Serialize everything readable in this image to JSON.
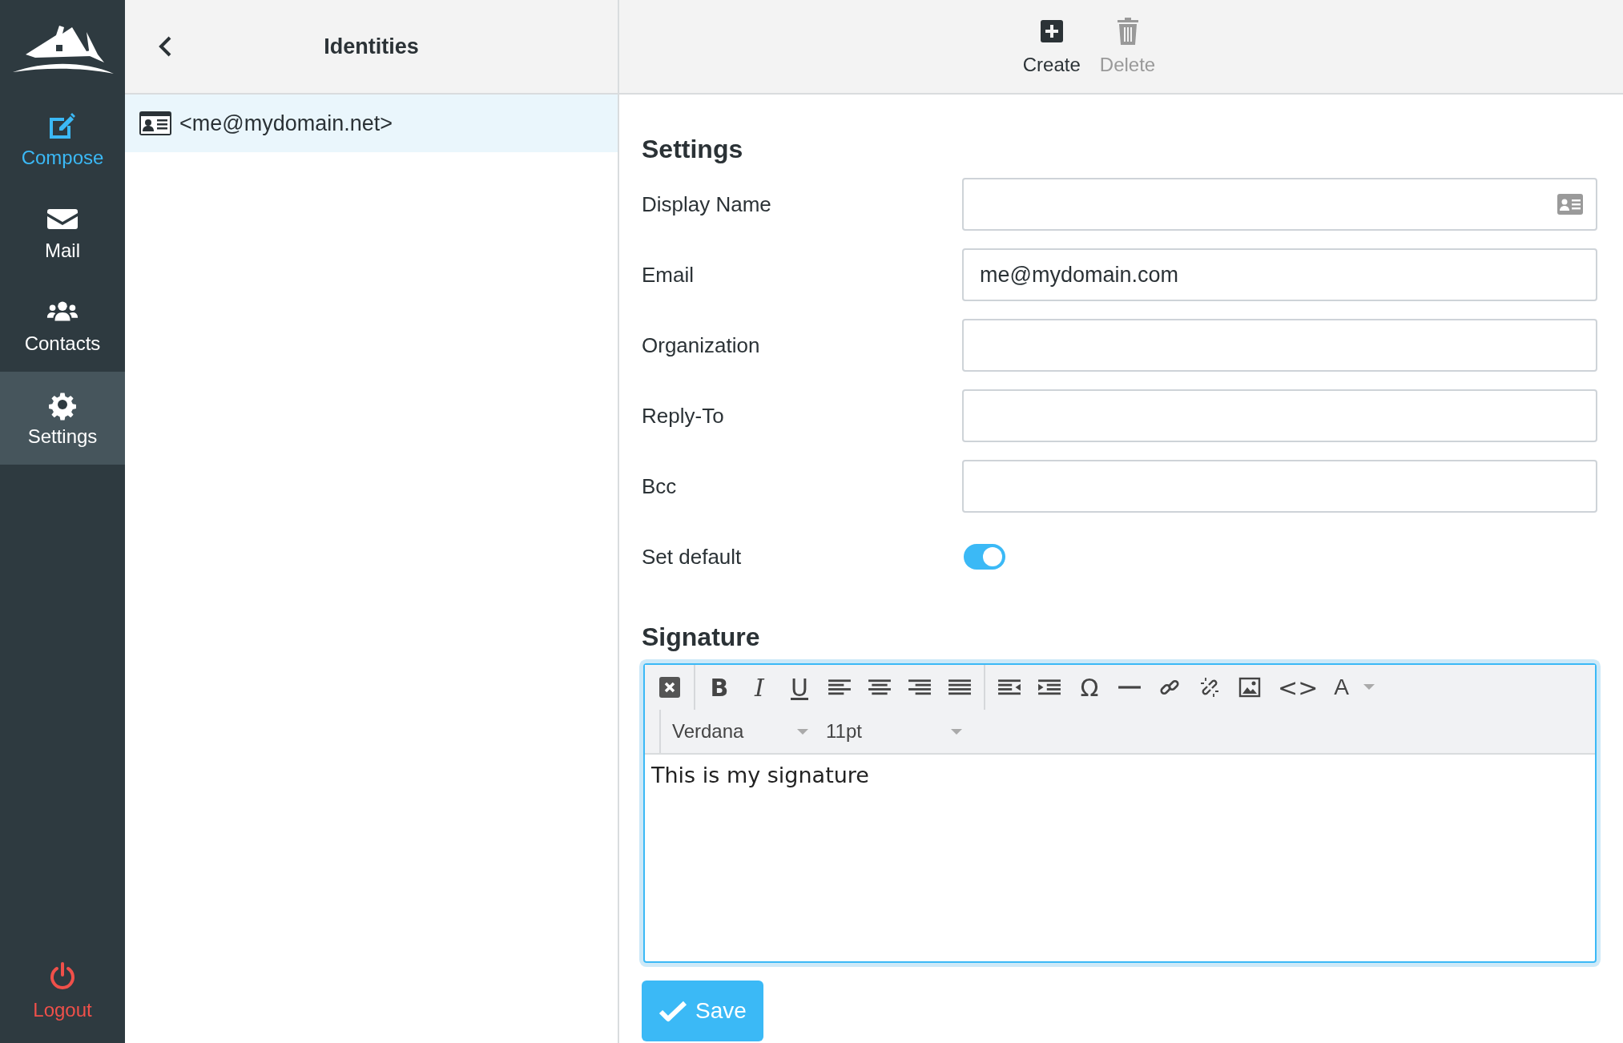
{
  "sidebar": {
    "items": [
      {
        "label": "Compose",
        "kind": "compose",
        "selected": false
      },
      {
        "label": "Mail",
        "kind": "mail",
        "selected": false
      },
      {
        "label": "Contacts",
        "kind": "contacts",
        "selected": false
      },
      {
        "label": "Settings",
        "kind": "settings",
        "selected": true
      }
    ],
    "logout": "Logout"
  },
  "identities": {
    "title": "Identities",
    "items": [
      {
        "label": "<me@mydomain.net>",
        "selected": true
      }
    ]
  },
  "actions": [
    {
      "label": "Create",
      "kind": "create",
      "disabled": false
    },
    {
      "label": "Delete",
      "kind": "delete",
      "disabled": true
    }
  ],
  "settings": {
    "title": "Settings",
    "fields": [
      {
        "label": "Display Name",
        "kind": "text",
        "card_icon": true
      },
      {
        "label": "Email",
        "kind": "text",
        "value": "me@mydomain.com",
        "card_icon": false
      },
      {
        "label": "Organization",
        "kind": "text",
        "card_icon": false
      },
      {
        "label": "Reply-To",
        "kind": "text",
        "card_icon": false
      },
      {
        "label": "Bcc",
        "kind": "text",
        "card_icon": false
      },
      {
        "label": "Set default",
        "kind": "toggle",
        "on": true
      }
    ]
  },
  "signature": {
    "title": "Signature",
    "tool_groups": [
      [
        {
          "kind": "clear"
        }
      ],
      [
        {
          "kind": "bold",
          "label": "B"
        },
        {
          "kind": "italic",
          "label": "I"
        },
        {
          "kind": "underline",
          "label": "U"
        },
        {
          "kind": "align-left"
        },
        {
          "kind": "align-center"
        },
        {
          "kind": "align-right"
        },
        {
          "kind": "justify"
        }
      ],
      [
        {
          "kind": "outdent"
        },
        {
          "kind": "indent"
        },
        {
          "kind": "glyph",
          "label": "Ω"
        },
        {
          "kind": "rule"
        },
        {
          "kind": "link"
        },
        {
          "kind": "unlink"
        },
        {
          "kind": "image"
        },
        {
          "kind": "glyph",
          "label": "<>"
        },
        {
          "kind": "text-color",
          "label": "A"
        }
      ]
    ],
    "font": "Verdana",
    "size": "11pt",
    "text": "This is my signature"
  },
  "save": "Save"
}
